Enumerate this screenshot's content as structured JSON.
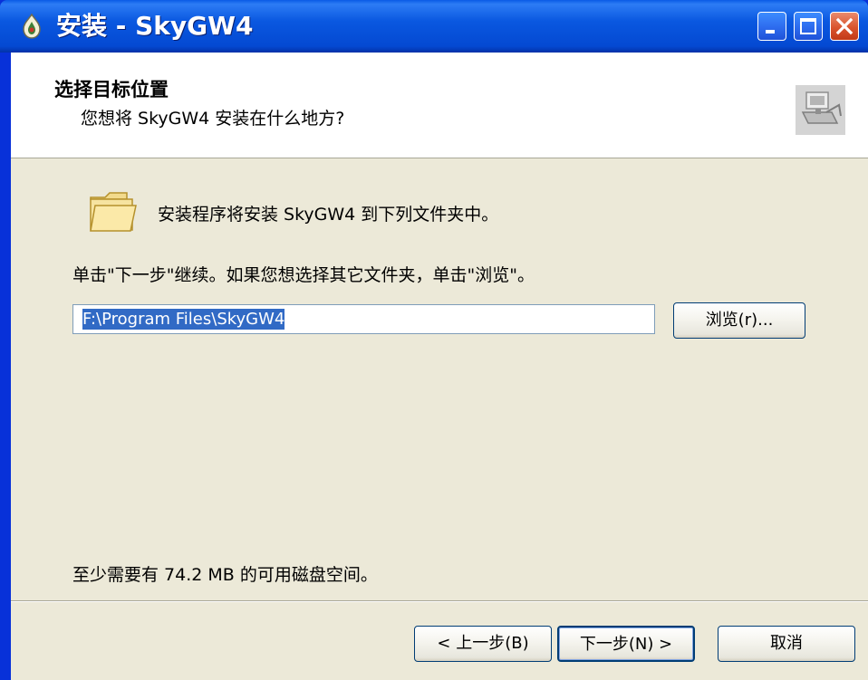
{
  "window": {
    "title": "安装 - SkyGW4",
    "icon": "setup-icon",
    "controls": {
      "minimize_icon": "minimize-icon",
      "maximize_icon": "maximize-icon",
      "close_icon": "close-icon"
    }
  },
  "header": {
    "title": "选择目标位置",
    "subtitle": "您想将 SkyGW4 安装在什么地方?",
    "image_icon": "install-wizard-icon"
  },
  "body": {
    "folder_icon": "folder-icon",
    "folder_text": "安装程序将安装 SkyGW4 到下列文件夹中。",
    "instruction": "单击\"下一步\"继续。如果您想选择其它文件夹，单击\"浏览\"。",
    "path_value": "F:\\Program Files\\SkyGW4",
    "browse_label": "浏览(r)...",
    "disk_space": "至少需要有 74.2 MB 的可用磁盘空间。"
  },
  "footer": {
    "back_label": "< 上一步(B)",
    "next_label": "下一步(N) >",
    "cancel_label": "取消"
  },
  "colors": {
    "titlebar": "#0A58E0",
    "window_bg": "#ECE9D8",
    "selection": "#316AC5",
    "close_button": "#DA542D"
  }
}
